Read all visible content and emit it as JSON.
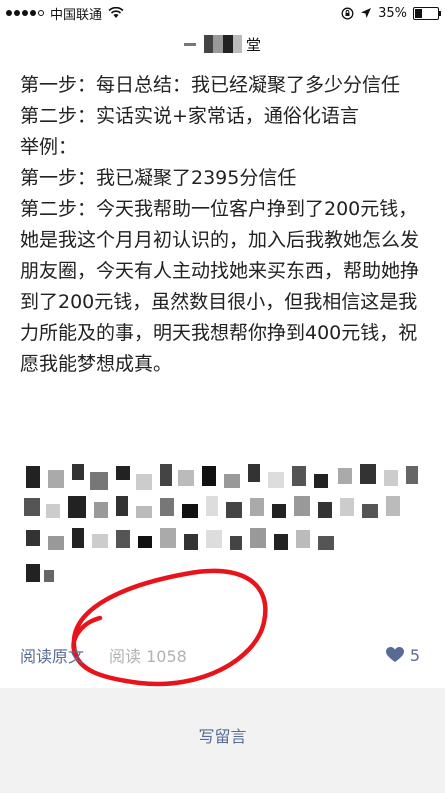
{
  "status": {
    "carrier": "中国联通",
    "battery": "35%",
    "battery_level": 0.35
  },
  "header": {
    "title_suffix": "堂"
  },
  "article": {
    "lines": [
      "第一步：每日总结：我已经凝聚了多少分信任",
      "第二步：实话实说+家常话，通俗化语言",
      "举例：",
      "第一步：我已凝聚了2395分信任",
      "第二步：今天我帮助一位客户挣到了200元钱，她是我这个月月初认识的，加入后我教她怎么发朋友圈，今天有人主动找她来买东西，帮助她挣到了200元钱，虽然数目很小，但我相信这是我力所能及的事，明天我想帮你挣到400元钱，祝愿我能梦想成真。"
    ]
  },
  "footer": {
    "read_original": "阅读原文",
    "read_count": "阅读 1058",
    "like_count": "5"
  },
  "comment": {
    "write_label": "写留言"
  },
  "colors": {
    "link": "#576b95",
    "annotation": "#e8141c"
  },
  "icons": {
    "wifi": "wifi-icon",
    "location": "location-arrow-icon",
    "lock": "orientation-lock-icon",
    "heart": "heart-icon"
  }
}
